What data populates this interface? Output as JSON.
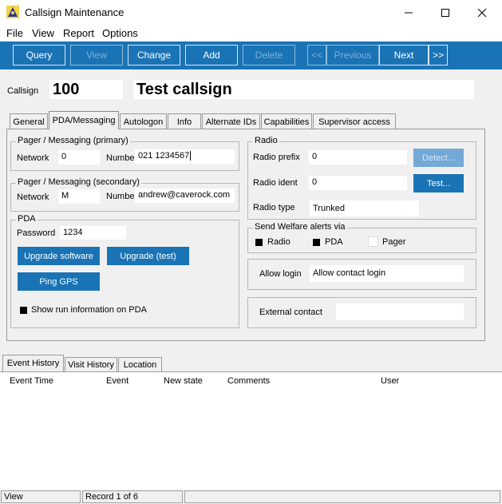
{
  "window": {
    "title": "Callsign Maintenance",
    "icon": "app-icon",
    "controls": {
      "minimize": "minimize-icon",
      "maximize": "maximize-icon",
      "close": "close-icon"
    }
  },
  "menu": {
    "file": "File",
    "view": "View",
    "report": "Report",
    "options": "Options"
  },
  "toolbar": {
    "query": "Query",
    "view": "View",
    "change": "Change",
    "add": "Add",
    "delete": "Delete",
    "first": "<<",
    "previous": "Previous",
    "next": "Next",
    "last": ">>",
    "accent_color": "#1a73b5"
  },
  "header": {
    "callsign_label": "Callsign",
    "callsign_value": "100",
    "description": "Test callsign"
  },
  "tabs": [
    {
      "label": "General"
    },
    {
      "label": "PDA/Messaging"
    },
    {
      "label": "Autologon"
    },
    {
      "label": "Info"
    },
    {
      "label": "Alternate IDs"
    },
    {
      "label": "Capabilities"
    },
    {
      "label": "Supervisor access"
    }
  ],
  "pager_primary": {
    "title": "Pager / Messaging (primary)",
    "network_label": "Network",
    "network_value": "0",
    "number_label": "Number",
    "number_value": "021 1234567"
  },
  "pager_secondary": {
    "title": "Pager / Messaging (secondary)",
    "network_label": "Network",
    "network_value": "M",
    "number_label": "Number",
    "number_value": "andrew@caverock.com"
  },
  "pda": {
    "title": "PDA",
    "password_label": "Password",
    "password_value": "1234",
    "upgrade_software": "Upgrade software",
    "upgrade_test": "Upgrade (test)",
    "ping_gps": "Ping GPS",
    "show_run_info": "Show run information on PDA"
  },
  "radio": {
    "title": "Radio",
    "prefix_label": "Radio prefix",
    "prefix_value": "0",
    "detect": "Detect...",
    "ident_label": "Radio ident",
    "ident_value": "0",
    "test": "Test...",
    "type_label": "Radio type",
    "type_value": "Trunked"
  },
  "welfare": {
    "title": "Send Welfare alerts via",
    "radio": "Radio",
    "pda": "PDA",
    "pager": "Pager"
  },
  "login": {
    "label": "Allow login",
    "value": "Allow contact login"
  },
  "external": {
    "label": "External contact",
    "value": ""
  },
  "bottom_tabs": [
    {
      "label": "Event History"
    },
    {
      "label": "Visit History"
    },
    {
      "label": "Location"
    }
  ],
  "event_columns": [
    "Event Time",
    "Event",
    "New state",
    "Comments",
    "User"
  ],
  "status": {
    "mode": "View",
    "record": "Record 1 of 6"
  }
}
